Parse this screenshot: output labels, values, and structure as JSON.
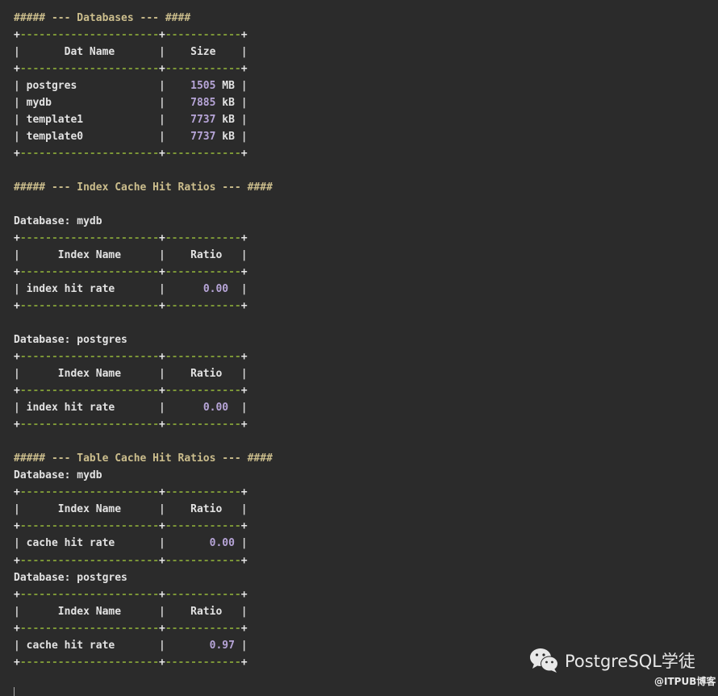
{
  "colors": {
    "background": "#2b2b2b",
    "dash": "#7f9a38",
    "heading": "#cbbd8c",
    "number": "#b7a5d8"
  },
  "lines": [
    [
      [
        "##### --- Databases --- ####",
        "h"
      ]
    ],
    [
      [
        "+",
        "p"
      ],
      [
        "----------------------",
        "d"
      ],
      [
        "+",
        "p"
      ],
      [
        "------------",
        "d"
      ],
      [
        "+",
        "p"
      ]
    ],
    [
      [
        "|",
        "b"
      ],
      [
        "       Dat Name       ",
        "t"
      ],
      [
        "|",
        "b"
      ],
      [
        "    Size    ",
        "t"
      ],
      [
        "|",
        "b"
      ]
    ],
    [
      [
        "+",
        "p"
      ],
      [
        "----------------------",
        "d"
      ],
      [
        "+",
        "p"
      ],
      [
        "------------",
        "d"
      ],
      [
        "+",
        "p"
      ]
    ],
    [
      [
        "|",
        "b"
      ],
      [
        " postgres             ",
        "t"
      ],
      [
        "|",
        "b"
      ],
      [
        "    ",
        "t"
      ],
      [
        "1505",
        "n"
      ],
      [
        " MB ",
        "t"
      ],
      [
        "|",
        "b"
      ]
    ],
    [
      [
        "|",
        "b"
      ],
      [
        " mydb                 ",
        "t"
      ],
      [
        "|",
        "b"
      ],
      [
        "    ",
        "t"
      ],
      [
        "7885",
        "n"
      ],
      [
        " kB ",
        "t"
      ],
      [
        "|",
        "b"
      ]
    ],
    [
      [
        "|",
        "b"
      ],
      [
        " template1            ",
        "t"
      ],
      [
        "|",
        "b"
      ],
      [
        "    ",
        "t"
      ],
      [
        "7737",
        "n"
      ],
      [
        " kB ",
        "t"
      ],
      [
        "|",
        "b"
      ]
    ],
    [
      [
        "|",
        "b"
      ],
      [
        " template0            ",
        "t"
      ],
      [
        "|",
        "b"
      ],
      [
        "    ",
        "t"
      ],
      [
        "7737",
        "n"
      ],
      [
        " kB ",
        "t"
      ],
      [
        "|",
        "b"
      ]
    ],
    [
      [
        "+",
        "p"
      ],
      [
        "----------------------",
        "d"
      ],
      [
        "+",
        "p"
      ],
      [
        "------------",
        "d"
      ],
      [
        "+",
        "p"
      ]
    ],
    [],
    [
      [
        "##### --- Index Cache Hit Ratios --- ####",
        "h"
      ]
    ],
    [],
    [
      [
        "Database: mydb",
        "t"
      ]
    ],
    [
      [
        "+",
        "p"
      ],
      [
        "----------------------",
        "d"
      ],
      [
        "+",
        "p"
      ],
      [
        "------------",
        "d"
      ],
      [
        "+",
        "p"
      ]
    ],
    [
      [
        "|",
        "b"
      ],
      [
        "      Index Name      ",
        "t"
      ],
      [
        "|",
        "b"
      ],
      [
        "    Ratio   ",
        "t"
      ],
      [
        "|",
        "b"
      ]
    ],
    [
      [
        "+",
        "p"
      ],
      [
        "----------------------",
        "d"
      ],
      [
        "+",
        "p"
      ],
      [
        "------------",
        "d"
      ],
      [
        "+",
        "p"
      ]
    ],
    [
      [
        "|",
        "b"
      ],
      [
        " index hit rate       ",
        "t"
      ],
      [
        "|",
        "b"
      ],
      [
        "      ",
        "t"
      ],
      [
        "0.00",
        "n"
      ],
      [
        "  ",
        "t"
      ],
      [
        "|",
        "b"
      ]
    ],
    [
      [
        "+",
        "p"
      ],
      [
        "----------------------",
        "d"
      ],
      [
        "+",
        "p"
      ],
      [
        "------------",
        "d"
      ],
      [
        "+",
        "p"
      ]
    ],
    [],
    [
      [
        "Database: postgres",
        "t"
      ]
    ],
    [
      [
        "+",
        "p"
      ],
      [
        "----------------------",
        "d"
      ],
      [
        "+",
        "p"
      ],
      [
        "------------",
        "d"
      ],
      [
        "+",
        "p"
      ]
    ],
    [
      [
        "|",
        "b"
      ],
      [
        "      Index Name      ",
        "t"
      ],
      [
        "|",
        "b"
      ],
      [
        "    Ratio   ",
        "t"
      ],
      [
        "|",
        "b"
      ]
    ],
    [
      [
        "+",
        "p"
      ],
      [
        "----------------------",
        "d"
      ],
      [
        "+",
        "p"
      ],
      [
        "------------",
        "d"
      ],
      [
        "+",
        "p"
      ]
    ],
    [
      [
        "|",
        "b"
      ],
      [
        " index hit rate       ",
        "t"
      ],
      [
        "|",
        "b"
      ],
      [
        "      ",
        "t"
      ],
      [
        "0.00",
        "n"
      ],
      [
        "  ",
        "t"
      ],
      [
        "|",
        "b"
      ]
    ],
    [
      [
        "+",
        "p"
      ],
      [
        "----------------------",
        "d"
      ],
      [
        "+",
        "p"
      ],
      [
        "------------",
        "d"
      ],
      [
        "+",
        "p"
      ]
    ],
    [],
    [
      [
        "##### --- Table Cache Hit Ratios --- ####",
        "h"
      ]
    ],
    [
      [
        "Database: mydb",
        "t"
      ]
    ],
    [
      [
        "+",
        "p"
      ],
      [
        "----------------------",
        "d"
      ],
      [
        "+",
        "p"
      ],
      [
        "------------",
        "d"
      ],
      [
        "+",
        "p"
      ]
    ],
    [
      [
        "|",
        "b"
      ],
      [
        "      Index Name      ",
        "t"
      ],
      [
        "|",
        "b"
      ],
      [
        "    Ratio   ",
        "t"
      ],
      [
        "|",
        "b"
      ]
    ],
    [
      [
        "+",
        "p"
      ],
      [
        "----------------------",
        "d"
      ],
      [
        "+",
        "p"
      ],
      [
        "------------",
        "d"
      ],
      [
        "+",
        "p"
      ]
    ],
    [
      [
        "|",
        "b"
      ],
      [
        " cache hit rate       ",
        "t"
      ],
      [
        "|",
        "b"
      ],
      [
        "       ",
        "t"
      ],
      [
        "0.00",
        "n"
      ],
      [
        " ",
        "t"
      ],
      [
        "|",
        "b"
      ]
    ],
    [
      [
        "+",
        "p"
      ],
      [
        "----------------------",
        "d"
      ],
      [
        "+",
        "p"
      ],
      [
        "------------",
        "d"
      ],
      [
        "+",
        "p"
      ]
    ],
    [
      [
        "Database: postgres",
        "t"
      ]
    ],
    [
      [
        "+",
        "p"
      ],
      [
        "----------------------",
        "d"
      ],
      [
        "+",
        "p"
      ],
      [
        "------------",
        "d"
      ],
      [
        "+",
        "p"
      ]
    ],
    [
      [
        "|",
        "b"
      ],
      [
        "      Index Name      ",
        "t"
      ],
      [
        "|",
        "b"
      ],
      [
        "    Ratio   ",
        "t"
      ],
      [
        "|",
        "b"
      ]
    ],
    [
      [
        "+",
        "p"
      ],
      [
        "----------------------",
        "d"
      ],
      [
        "+",
        "p"
      ],
      [
        "------------",
        "d"
      ],
      [
        "+",
        "p"
      ]
    ],
    [
      [
        "|",
        "b"
      ],
      [
        " cache hit rate       ",
        "t"
      ],
      [
        "|",
        "b"
      ],
      [
        "       ",
        "t"
      ],
      [
        "0.97",
        "n"
      ],
      [
        " ",
        "t"
      ],
      [
        "|",
        "b"
      ]
    ],
    [
      [
        "+",
        "p"
      ],
      [
        "----------------------",
        "d"
      ],
      [
        "+",
        "p"
      ],
      [
        "------------",
        "d"
      ],
      [
        "+",
        "p"
      ]
    ]
  ],
  "watermark": {
    "icon": "wechat-icon",
    "title": "PostgreSQL学徒",
    "subtitle": "@ITPUB博客"
  }
}
